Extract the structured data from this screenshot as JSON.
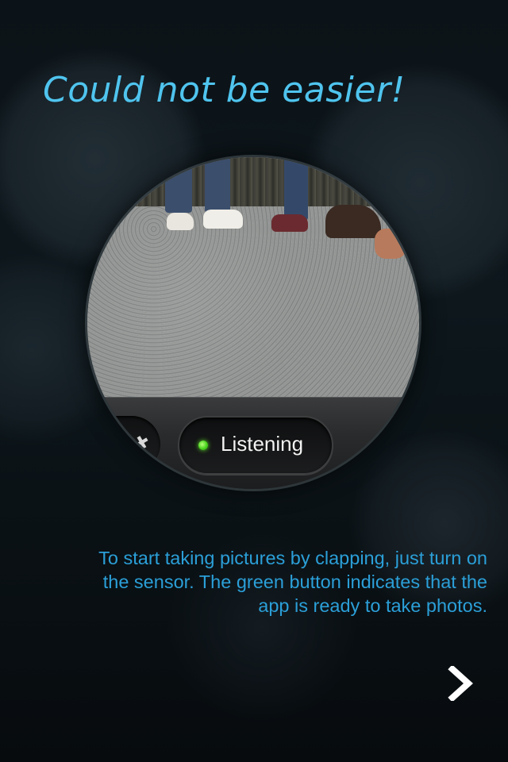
{
  "headline": "Could not be easier!",
  "preview": {
    "status_label": "Listening",
    "status_color": "#4ed21e"
  },
  "description": {
    "line1": "To start taking pictures by clapping, just turn on",
    "line2": "the sensor. The green button indicates that the",
    "line3": "app is ready to take photos."
  },
  "navigation": {
    "next_icon": "chevron-right-icon"
  },
  "colors": {
    "headline": "#4fc4ee",
    "body_text": "#2b9fd8",
    "background": "#0a1014"
  }
}
